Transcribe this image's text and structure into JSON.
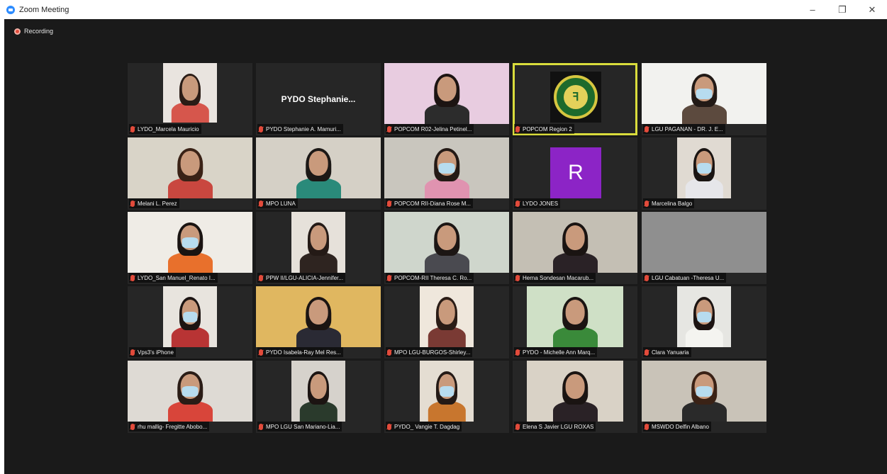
{
  "window": {
    "title": "Zoom Meeting",
    "minimize_icon": "–",
    "restore_icon": "❐",
    "close_icon": "✕"
  },
  "recording": {
    "label": "Recording"
  },
  "placeholder_name": "PYDO  Stephanie...",
  "avatar_letter": "R",
  "colors": {
    "active_speaker": "#d9dc3c",
    "mic_muted": "#e24b3b",
    "avatar_bg": "#8c24c6",
    "background": "#1a1a1a"
  },
  "participants": [
    {
      "name": "LYDO_Marcela Mauricio"
    },
    {
      "name": "PYDO Stephanie A. Mamuri..."
    },
    {
      "name": "POPCOM R02-Jelina Petinel..."
    },
    {
      "name": "POPCOM Region 2"
    },
    {
      "name": "LGU PAGANAN - DR. J. E..."
    },
    {
      "name": "Melani L. Perez"
    },
    {
      "name": "MPO LUNA"
    },
    {
      "name": "POPCOM RII-Diana Rose M..."
    },
    {
      "name": "LYDO JONES"
    },
    {
      "name": "Marcelina Balgo"
    },
    {
      "name": "LYDO_San Manuel_Renato I..."
    },
    {
      "name": "PPW II/LGU-ALICIA-Jennifer..."
    },
    {
      "name": "POPCOM-RII Theresa C. Ro..."
    },
    {
      "name": "Herna Sondesan Macarub..."
    },
    {
      "name": "LGU Cabatuan -Theresa U..."
    },
    {
      "name": "Vps3's iPhone"
    },
    {
      "name": "PYDO Isabela-Ray Mel Res..."
    },
    {
      "name": "MPO LGU-BURGOS-Shirley..."
    },
    {
      "name": "PYDO - Michelle Ann Marq..."
    },
    {
      "name": "Clara Yanuaria"
    },
    {
      "name": "rhu mallig- Fregitte Abobo..."
    },
    {
      "name": "MPO LGU San Mariano-Lia..."
    },
    {
      "name": "PYDO_ Vangie T. Dagdag"
    },
    {
      "name": "Elena S Javier LGU ROXAS"
    },
    {
      "name": "MSWDO Delfin Albano"
    }
  ]
}
